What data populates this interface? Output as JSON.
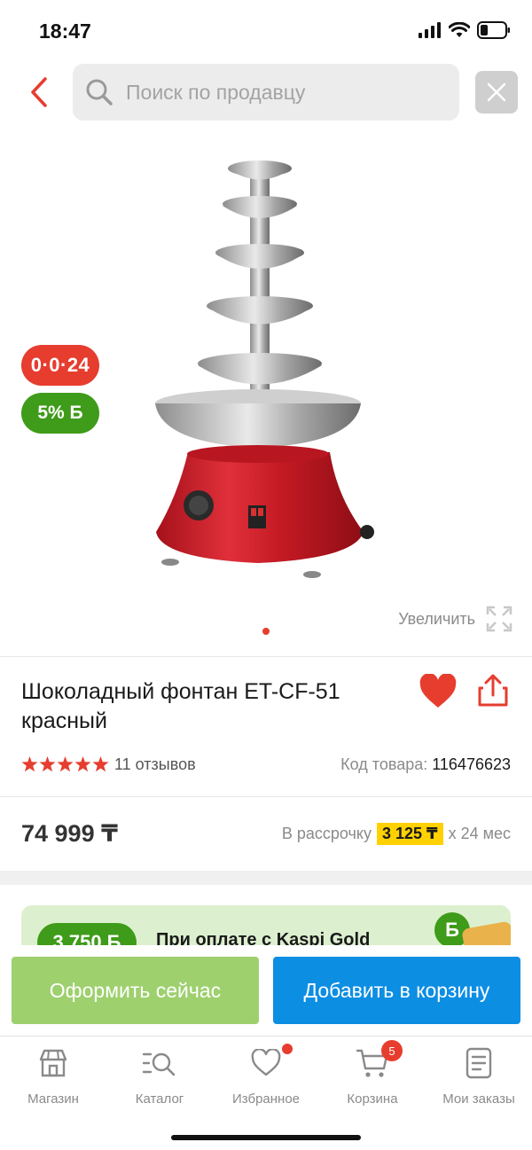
{
  "status_bar": {
    "time": "18:47"
  },
  "search": {
    "placeholder": "Поиск по продавцу"
  },
  "badges": {
    "credit": "0·0·24",
    "bonus": "5% Б"
  },
  "gallery": {
    "zoom_label": "Увеличить"
  },
  "product": {
    "title": "Шоколадный фонтан ET-CF-51 красный",
    "reviews": "11 отзывов",
    "rating": 5,
    "sku_label": "Код товара:",
    "sku_value": "116476623",
    "price": "74 999 ₸",
    "installment_prefix": "В рассрочку",
    "installment_amount": "3 125 ₸",
    "installment_suffix": "х 24 мес"
  },
  "promo": {
    "bonus_amount": "3 750 Б",
    "text": "При оплате с Kaspi Gold",
    "coin": "Б"
  },
  "actions": {
    "buy_now": "Оформить сейчас",
    "add_to_cart": "Добавить в корзину"
  },
  "tabs": [
    {
      "label": "Магазин",
      "icon": "store-icon"
    },
    {
      "label": "Каталог",
      "icon": "catalog-icon"
    },
    {
      "label": "Избранное",
      "icon": "heart-icon"
    },
    {
      "label": "Корзина",
      "icon": "cart-icon",
      "badge": "5"
    },
    {
      "label": "Мои заказы",
      "icon": "orders-icon"
    }
  ],
  "colors": {
    "accent_red": "#e63d2f",
    "bonus_green": "#3f9b1a",
    "cart_blue": "#0c8ee3",
    "buy_green": "#9ed06e",
    "installment_yellow": "#ffd100"
  }
}
